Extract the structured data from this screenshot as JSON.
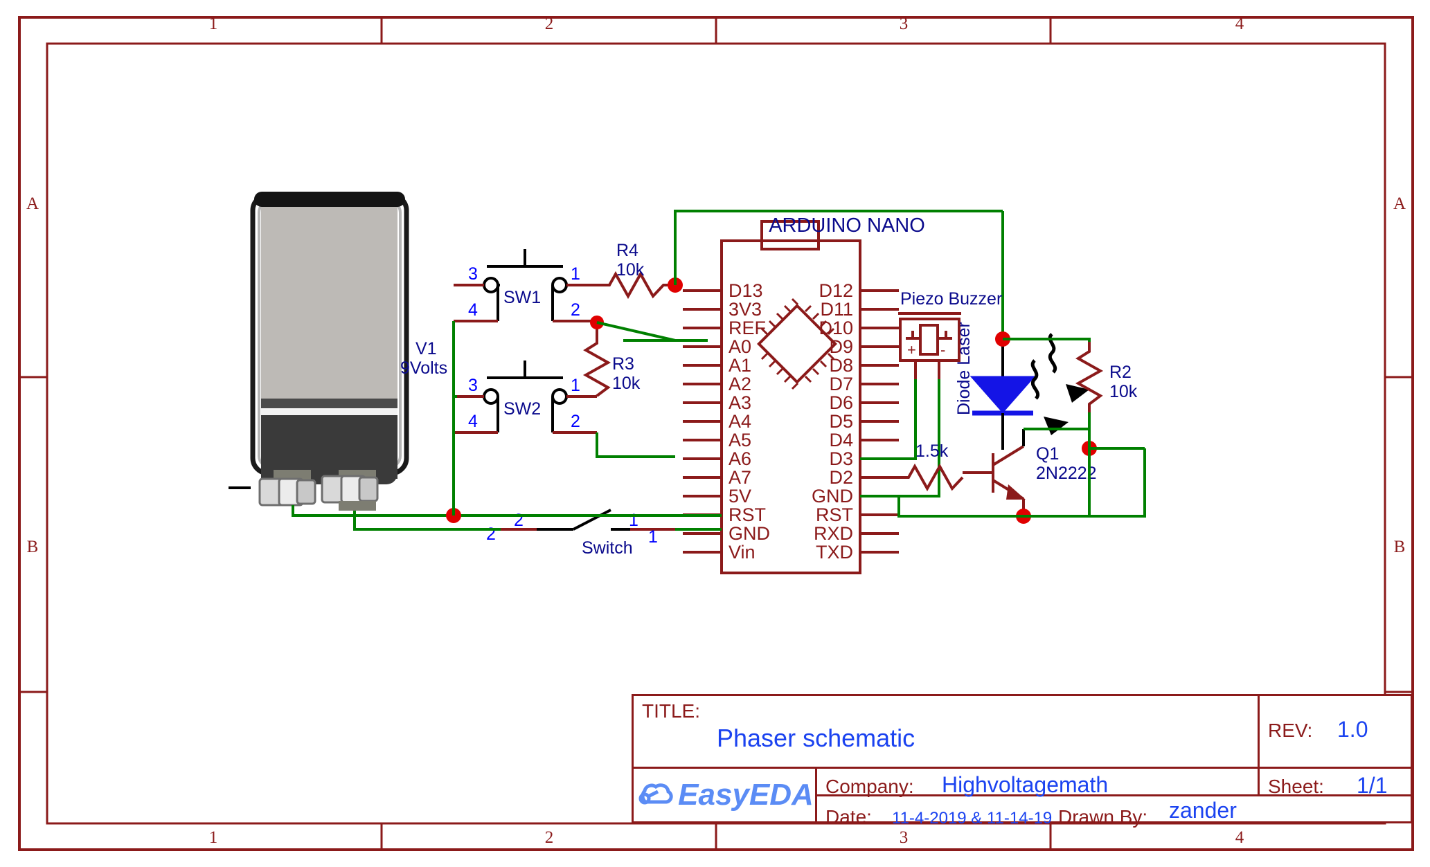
{
  "sheet": {
    "zones_top": [
      "1",
      "2",
      "3",
      "4"
    ],
    "zones_bottom": [
      "1",
      "2",
      "3",
      "4"
    ],
    "rows_left": [
      "A",
      "B"
    ],
    "rows_right": [
      "A",
      "B"
    ]
  },
  "components": {
    "battery": {
      "ref": "V1",
      "value": "9Volts"
    },
    "sw1": {
      "ref": "SW1",
      "pins": [
        "3",
        "4",
        "1",
        "2"
      ]
    },
    "sw2": {
      "ref": "SW2",
      "pins": [
        "3",
        "4",
        "1",
        "2"
      ]
    },
    "r4": {
      "ref": "R4",
      "value": "10k"
    },
    "r3": {
      "ref": "R3",
      "value": "10k"
    },
    "r2": {
      "ref": "R2",
      "value": "10k"
    },
    "rbase": {
      "value": "1.5k"
    },
    "q1": {
      "ref": "Q1",
      "value": "2N2222"
    },
    "buzzer": {
      "label": "Piezo Buzzer",
      "plus": "+",
      "minus": "-"
    },
    "laser": {
      "label": "Diode Laser"
    },
    "switch": {
      "label": "Switch",
      "pin_left_a": "2",
      "pin_left_b": "2",
      "pin_right_a": "1",
      "pin_right_b": "1"
    },
    "nano": {
      "title": "ARDUINO NANO",
      "pins_left": [
        "D13",
        "3V3",
        "REF",
        "A0",
        "A1",
        "A2",
        "A3",
        "A4",
        "A5",
        "A6",
        "A7",
        "5V",
        "RST",
        "GND",
        "Vin"
      ],
      "pins_right": [
        "D12",
        "D11",
        "D10",
        "D9",
        "D8",
        "D7",
        "D6",
        "D5",
        "D4",
        "D3",
        "D2",
        "GND",
        "RST",
        "RXD",
        "TXD"
      ]
    }
  },
  "titleblock": {
    "title_label": "TITLE:",
    "title_value": "Phaser schematic",
    "rev_label": "REV:",
    "rev_value": "1.0",
    "company_label": "Company:",
    "company_value": "Highvoltagemath",
    "sheet_label": "Sheet:",
    "sheet_value": "1/1",
    "date_label": "Date:",
    "date_value": "11-4-2019 & 11-14-19",
    "drawn_label": "Drawn By:",
    "drawn_value": "zander",
    "logo_text": "EasyEDA"
  },
  "colors": {
    "frame": "#8b1a1a",
    "wire_green": "#008000",
    "wire_red": "#8b1a1a",
    "label_blue": "#0a0a8c",
    "node_red": "#e00000",
    "laser_blue": "#1414e6"
  }
}
